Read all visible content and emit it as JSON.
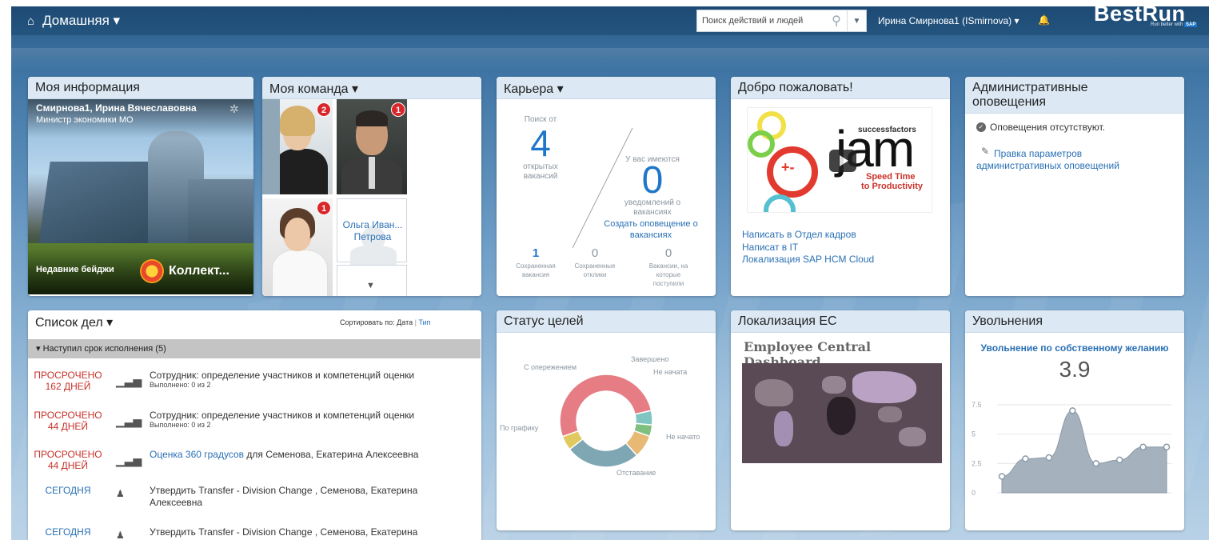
{
  "header": {
    "home_label": "Домашняя ▾",
    "search_placeholder": "Поиск действий и людей",
    "user_label": "Ирина Смирнова1 (ISmirnova) ▾",
    "brand": "BestRun",
    "brand_sub": "Run better with",
    "sap": "SAP"
  },
  "my_info": {
    "title": "Моя информация",
    "name": "Смирнова1, Ирина Вячеславовна",
    "role": "Министр экономики МО",
    "badges_label": "Недавние бейджи",
    "badge_name": "Коллект..."
  },
  "team": {
    "title": "Моя команда ▾",
    "badges": [
      "2",
      "1",
      "1"
    ],
    "person_name_1": "Ольга Иван...",
    "person_name_2": "Петрова"
  },
  "career": {
    "title": "Карьера ▾",
    "search_from": "Поиск от",
    "open_count": "4",
    "open_label_1": "открытых",
    "open_label_2": "вакансий",
    "have_label": "У вас имеются",
    "notif_count": "0",
    "notif_label_1": "уведомлений о",
    "notif_label_2": "вакансиях",
    "create_alert_1": "Создать оповещение о",
    "create_alert_2": "вакансиях",
    "stats": [
      {
        "value": "1",
        "label1": "Сохраненная",
        "label2": "вакансия"
      },
      {
        "value": "0",
        "label1": "Сохраненные",
        "label2": "отклики"
      },
      {
        "value": "0",
        "label1": "Вакансии, на",
        "label2": "которые",
        "label3": "поступили"
      }
    ]
  },
  "welcome": {
    "title": "Добро пожаловать!",
    "video_brand": "successfactors",
    "video_word": "jam",
    "video_tag_1": "Speed Time",
    "video_tag_2": "to Productivity",
    "links": [
      "Написать в Отдел кадров",
      "Написат в IT",
      "Локализация SAP HCM Cloud"
    ]
  },
  "admin": {
    "title_1": "Административные",
    "title_2": "оповещения",
    "none_text": "Оповещения отсутствуют.",
    "edit_link_1": "Правка параметров",
    "edit_link_2": "административных оповещений"
  },
  "todo": {
    "title": "Список дел ▾",
    "sort_label": "Сортировать по:",
    "sort_date": "Дата",
    "sort_sep": "|",
    "sort_type": "Тип",
    "group": "Наступил срок исполнения (5)",
    "rows": [
      {
        "due1": "ПРОСРОЧЕНО",
        "due2": "162 ДНЕЙ",
        "title": "Сотрудник: определение участников и компетенций оценки",
        "sub": "Выполнено: 0 из 2"
      },
      {
        "due1": "ПРОСРОЧЕНО",
        "due2": "44 ДНЕЙ",
        "title": "Сотрудник: определение участников и компетенций оценки",
        "sub": "Выполнено: 0 из 2"
      },
      {
        "due1": "ПРОСРОЧЕНО",
        "due2": "44 ДНЕЙ",
        "title_link": "Оценка 360 градусов",
        "title_rest": " для Семенова, Екатерина Алексеевна"
      },
      {
        "due1": "СЕГОДНЯ",
        "title": "Утвердить Transfer - Division Change , Семенова, Екатерина Алексеевна"
      },
      {
        "due1": "СЕГОДНЯ",
        "title": "Утвердить Transfer - Division Change , Семенова, Екатерина"
      }
    ]
  },
  "goals": {
    "title": "Статус целей"
  },
  "chart_data": [
    {
      "type": "pie",
      "title": "",
      "categories": [
        "По графику",
        "С опережением",
        "Завершено",
        "Не начата",
        "Не начато",
        "Отставание"
      ],
      "values": [
        52,
        5,
        4,
        8,
        26,
        5
      ],
      "colors": [
        "#e67c84",
        "#7fc5c2",
        "#7fbf7f",
        "#e8b875",
        "#7fa6b3",
        "#e0c95e"
      ]
    },
    {
      "type": "area",
      "title": "Увольнение по собственному желанию",
      "x": [
        1,
        2,
        3,
        4,
        5,
        6,
        7,
        8,
        9,
        10
      ],
      "values": [
        1.4,
        2.9,
        3.0,
        7.0,
        2.5,
        2.8,
        3.9,
        3.9
      ],
      "ylim": [
        0,
        7.5
      ],
      "yticks": [
        "7.5",
        "5",
        "2.5",
        "0"
      ]
    }
  ],
  "ec": {
    "title": "Локализация EC",
    "dashboard_title": "Employee Central Dashboard"
  },
  "terminations": {
    "title": "Увольнения",
    "subtitle": "Увольнение по собственному желанию",
    "value": "3.9"
  }
}
